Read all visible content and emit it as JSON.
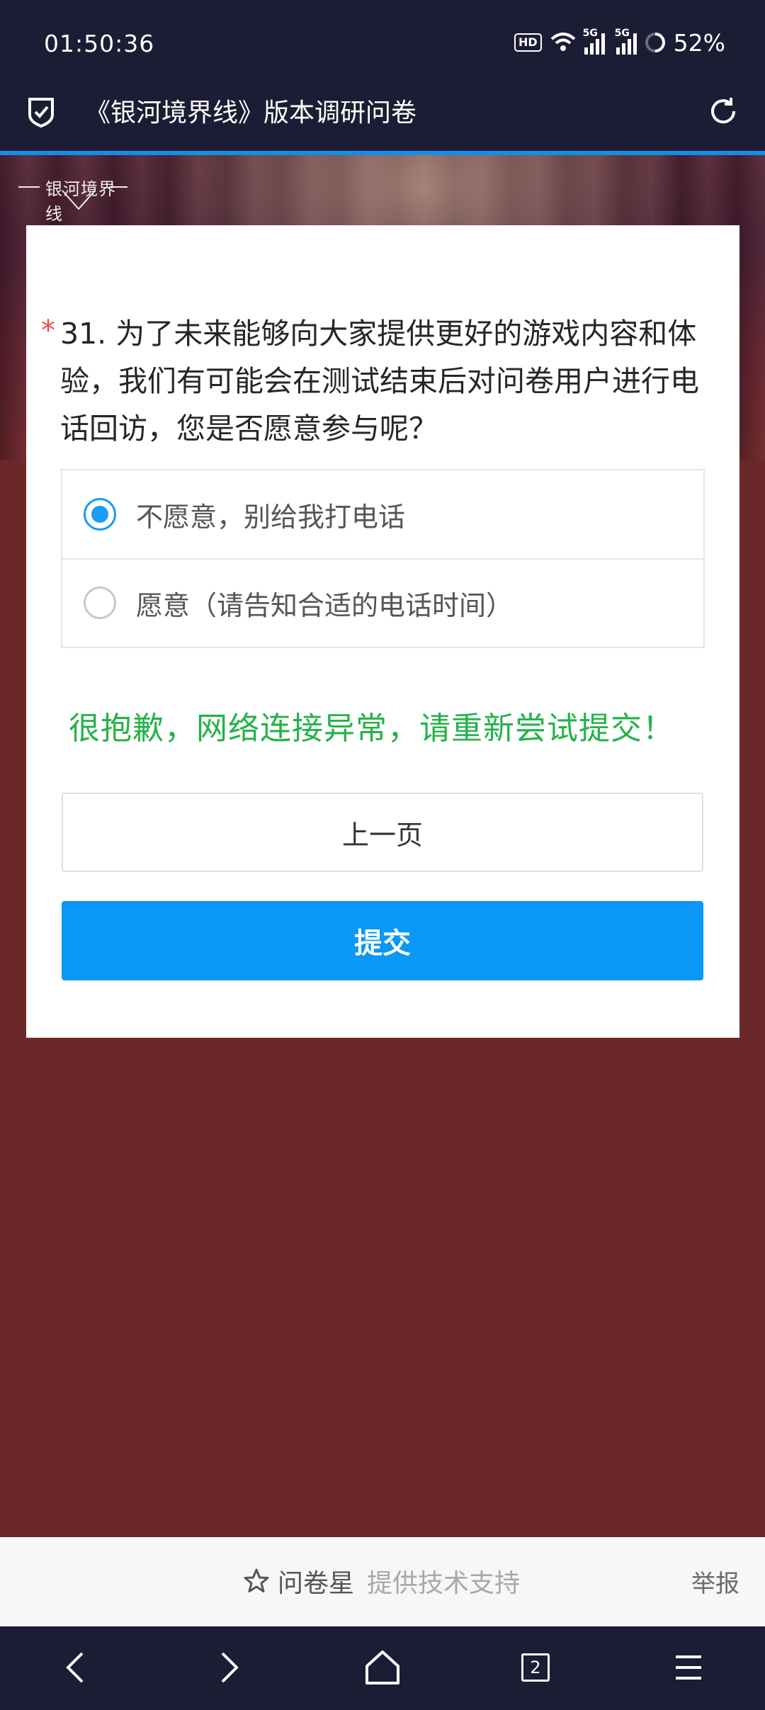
{
  "status_bar": {
    "time": "01:50:36",
    "hd_label": "HD",
    "net1": "5G",
    "net2": "5G",
    "battery": "52%"
  },
  "browser": {
    "page_title": "《银河境界线》版本调研问卷",
    "accent_color": "#0f8fe8"
  },
  "banner": {
    "logo_text": "银河境界线"
  },
  "question": {
    "required_mark": "*",
    "text": "31. 为了未来能够向大家提供更好的游戏内容和体验，我们有可能会在测试结束后对问卷用户进行电话回访，您是否愿意参与呢？",
    "options": [
      {
        "label": "不愿意，别给我打电话",
        "selected": true
      },
      {
        "label": "愿意（请告知合适的电话时间）",
        "selected": false
      }
    ]
  },
  "error_message": "很抱歉，网络连接异常，请重新尝试提交！",
  "buttons": {
    "prev": "上一页",
    "submit": "提交"
  },
  "footer": {
    "brand": "问卷星",
    "tagline": "提供技术支持",
    "report": "举报"
  },
  "nav": {
    "tab_count": "2"
  },
  "colors": {
    "page_bg": "#6a2828",
    "submit_bg": "#0a97f5",
    "error_text": "#24b24a",
    "required": "#f24b4b"
  }
}
